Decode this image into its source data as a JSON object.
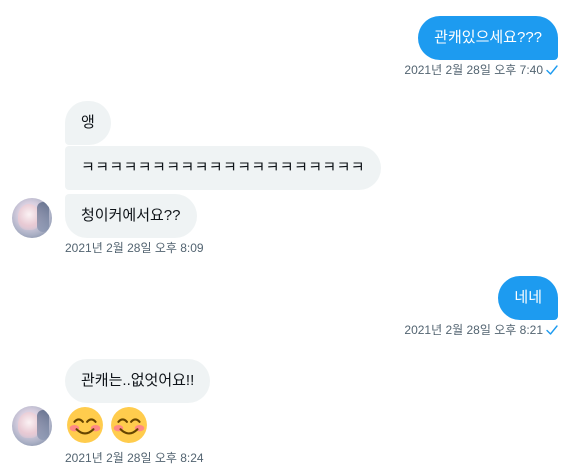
{
  "colors": {
    "sent_bubble": "#1d9bf0",
    "received_bubble": "#eff3f4",
    "meta_text": "#536471",
    "read_check": "#1d9bf0"
  },
  "messages": {
    "sent_1": {
      "text": "관캐있으세요???",
      "timestamp": "2021년 2월 28일 오후 7:40"
    },
    "recv_group_1": {
      "bubble_1": "앵",
      "bubble_2": "ㅋㅋㅋㅋㅋㅋㅋㅋㅋㅋㅋㅋㅋㅋㅋㅋㅋㅋㅋㅋ",
      "bubble_3": "청이커에서요??",
      "timestamp": "2021년 2월 28일 오후 8:09"
    },
    "sent_2": {
      "text": "네네",
      "timestamp": "2021년 2월 28일 오후 8:21"
    },
    "recv_group_2": {
      "bubble_1": "관캐는..없엇어요!!",
      "emojis": [
        "smiling-face-with-smiling-eyes",
        "smiling-face-with-smiling-eyes"
      ],
      "timestamp": "2021년 2월 28일 오후 8:24"
    }
  },
  "icons": {
    "read_receipt": "check-icon",
    "emoji": "smiling-face-icon"
  }
}
